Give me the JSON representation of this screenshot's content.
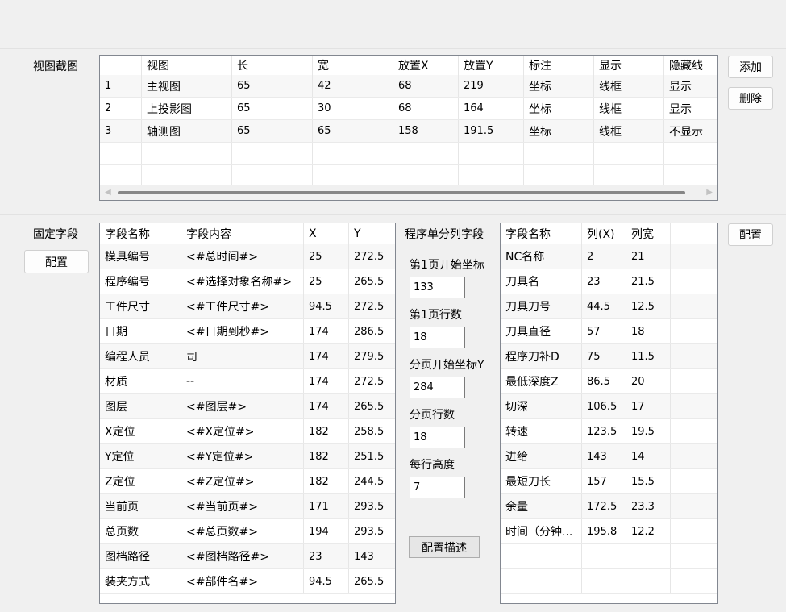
{
  "view_section": {
    "label": "视图截图",
    "buttons": {
      "add": "添加",
      "delete": "删除"
    },
    "columns": [
      "",
      "视图",
      "长",
      "宽",
      "放置X",
      "放置Y",
      "标注",
      "显示",
      "隐藏线"
    ],
    "rows": [
      [
        "1",
        "主视图",
        "65",
        "42",
        "68",
        "219",
        "坐标",
        "线框",
        "显示"
      ],
      [
        "2",
        "上投影图",
        "65",
        "30",
        "68",
        "164",
        "坐标",
        "线框",
        "显示"
      ],
      [
        "3",
        "轴测图",
        "65",
        "65",
        "158",
        "191.5",
        "坐标",
        "线框",
        "不显示"
      ]
    ],
    "scrollbar": {
      "left_arrow": "◀",
      "right_arrow": "▶"
    }
  },
  "fixed_section": {
    "label": "固定字段",
    "config_button": "配置",
    "columns": [
      "字段名称",
      "字段内容",
      "X",
      "Y"
    ],
    "rows": [
      [
        "模具编号",
        "<#总时间#>",
        "25",
        "272.5"
      ],
      [
        "程序编号",
        "<#选择对象名称#>",
        "25",
        "265.5"
      ],
      [
        "工件尺寸",
        "<#工件尺寸#>",
        "94.5",
        "272.5"
      ],
      [
        "日期",
        "<#日期到秒#>",
        "174",
        "286.5"
      ],
      [
        "编程人员",
        "司",
        "174",
        "279.5"
      ],
      [
        "材质",
        "--",
        "174",
        "272.5"
      ],
      [
        "图层",
        "<#图层#>",
        "174",
        "265.5"
      ],
      [
        "X定位",
        "<#X定位#>",
        "182",
        "258.5"
      ],
      [
        "Y定位",
        "<#Y定位#>",
        "182",
        "251.5"
      ],
      [
        "Z定位",
        "<#Z定位#>",
        "182",
        "244.5"
      ],
      [
        "当前页",
        "<#当前页#>",
        "171",
        "293.5"
      ],
      [
        "总页数",
        "<#总页数#>",
        "194",
        "293.5"
      ],
      [
        "图档路径",
        "<#图档路径#>",
        "23",
        "143"
      ],
      [
        "装夹方式",
        "<#部件名#>",
        "94.5",
        "265.5"
      ]
    ]
  },
  "column_section": {
    "title": "程序单分列字段",
    "fields": [
      {
        "label": "第1页开始坐标",
        "value": "133"
      },
      {
        "label": "第1页行数",
        "value": "18"
      },
      {
        "label": "分页开始坐标Y",
        "value": "284"
      },
      {
        "label": "分页行数",
        "value": "18"
      },
      {
        "label": "每行高度",
        "value": "7"
      }
    ],
    "describe_button": "配置描述",
    "config_button": "配置",
    "columns": [
      "字段名称",
      "列(X)",
      "列宽"
    ],
    "rows": [
      [
        "NC名称",
        "2",
        "21"
      ],
      [
        "刀具名",
        "23",
        "21.5"
      ],
      [
        "刀具刀号",
        "44.5",
        "12.5"
      ],
      [
        "刀具直径",
        "57",
        "18"
      ],
      [
        "程序刀补D",
        "75",
        "11.5"
      ],
      [
        "最低深度Z",
        "86.5",
        "20"
      ],
      [
        "切深",
        "106.5",
        "17"
      ],
      [
        "转速",
        "123.5",
        "19.5"
      ],
      [
        "进给",
        "143",
        "14"
      ],
      [
        "最短刀长",
        "157",
        "15.5"
      ],
      [
        "余量",
        "172.5",
        "23.3"
      ],
      [
        "时间（分钟...",
        "195.8",
        "12.2"
      ]
    ]
  }
}
